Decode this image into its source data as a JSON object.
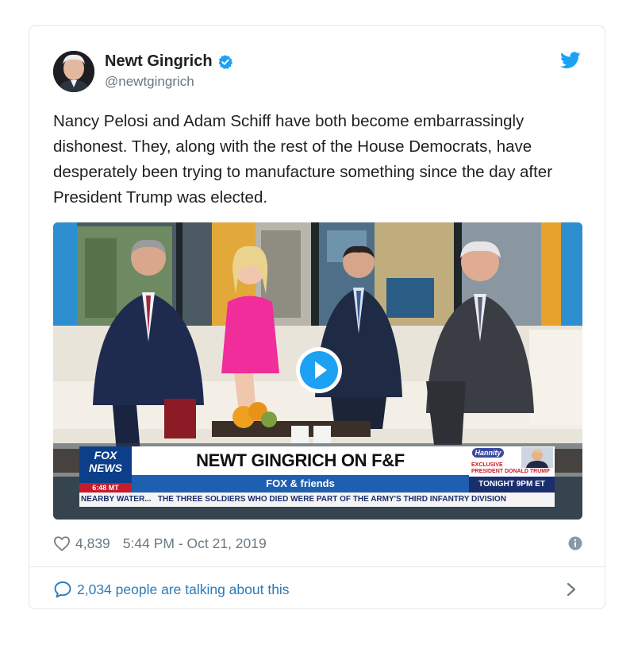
{
  "author": {
    "name": "Newt Gingrich",
    "handle": "@newtgingrich"
  },
  "tweet": {
    "text": "Nancy Pelosi and Adam Schiff have both become embarrassingly dishonest. They, along with the rest of the House Democrats, have desperately been trying to manufacture something since the day after President Trump was elected."
  },
  "video": {
    "headline": "NEWT GINGRICH ON F&F",
    "network_logo": "FOX NEWS",
    "time": "6:48 MT",
    "show_name": "FOX & friends",
    "promo_exclusive": "EXCLUSIVE",
    "promo_line": "PRESIDENT DONALD TRUMP",
    "promo_time": "TONIGHT 9PM ET",
    "promo_show": "Hannity",
    "ticker": "NEARBY WATER...   THE THREE SOLDIERS WHO DIED WERE PART OF THE ARMY'S THIRD INFANTRY DIVISION"
  },
  "meta": {
    "likes": "4,839",
    "timestamp": "5:44 PM - Oct 21, 2019"
  },
  "footer": {
    "talking": "2,034 people are talking about this"
  },
  "colors": {
    "link": "#2b7bb9",
    "twitter_blue": "#1da1f2",
    "muted": "#697882"
  },
  "icons": [
    "verified-icon",
    "twitter-bird-icon",
    "play-icon",
    "heart-icon",
    "info-icon",
    "comment-icon",
    "chevron-right-icon"
  ]
}
